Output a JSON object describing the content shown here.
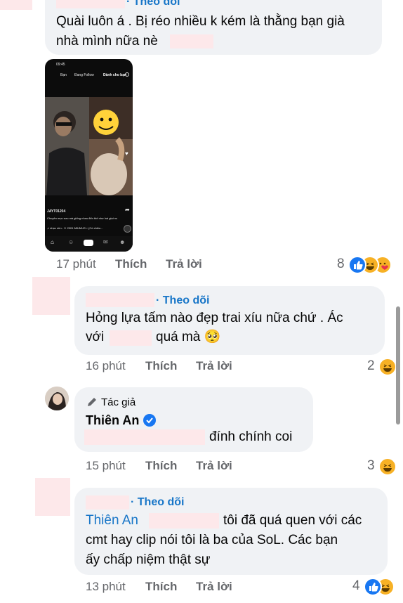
{
  "colors": {
    "bubble": "#f0f2f5",
    "link": "#1876c8",
    "meta": "#65676b",
    "redaction": "#fde8ea",
    "like": "#1877f2",
    "haha": "#f7b125"
  },
  "comments": [
    {
      "follow": "· Theo dõi",
      "text_lines": [
        "Quài luôn á . Bị réo nhiều k kém là thằng bạn già",
        "nhà mình nữa nè"
      ],
      "phone_attachment": {
        "status_time": "09:45",
        "tabs": [
          "Bạn",
          "Đang Follow",
          "Dành cho bạn"
        ],
        "username": "JAYT01204",
        "caption": "Chuyên mục sưu mà giống nhau đến thế như hai giọt nước thế này 😂😂😂... thêm",
        "music": "♫ nhạc nền - ✈ 2001 MIUMUS ♪ (Có chiều..."
      },
      "time": "17 phút",
      "like": "Thích",
      "reply": "Trả lời",
      "reaction_count": "8",
      "reactions": [
        "like-icon",
        "haha-icon",
        "love-icon"
      ]
    },
    {
      "follow": "· Theo dõi",
      "text_lines": [
        "Hỏng lựa tấm nào đẹp trai xíu nữa chứ . Ác",
        "với",
        "quá mà 🥺"
      ],
      "time": "16 phút",
      "like": "Thích",
      "reply": "Trả lời",
      "reaction_count": "2",
      "reactions": [
        "haha-icon"
      ]
    },
    {
      "author_badge": "Tác giả",
      "author_name": "Thiên An",
      "text": "đính chính coi",
      "time": "15 phút",
      "like": "Thích",
      "reply": "Trả lời",
      "reaction_count": "3",
      "reactions": [
        "haha-icon"
      ]
    },
    {
      "follow": "· Theo dõi",
      "mention": "Thiên An",
      "text_lines": [
        "tôi đã quá quen với các",
        "cmt hay clip nói tôi là ba của SoL. Các bạn",
        "ấy chấp niệm thật sự"
      ],
      "time": "13 phút",
      "like": "Thích",
      "reply": "Trả lời",
      "reaction_count": "4",
      "reactions": [
        "like-icon",
        "haha-icon"
      ]
    }
  ]
}
